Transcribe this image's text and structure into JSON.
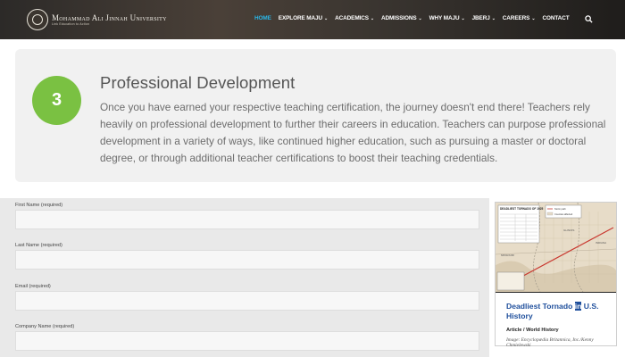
{
  "header": {
    "logo_name": "Mohammad Ali Jinnah University",
    "logo_subtitle": "Link Education to Action",
    "nav": [
      {
        "label": "HOME",
        "active": true,
        "dropdown": false
      },
      {
        "label": "EXPLORE MAJU",
        "active": false,
        "dropdown": true
      },
      {
        "label": "ACADEMICS",
        "active": false,
        "dropdown": true
      },
      {
        "label": "ADMISSIONS",
        "active": false,
        "dropdown": true
      },
      {
        "label": "WHY MAJU",
        "active": false,
        "dropdown": true
      },
      {
        "label": "JBERJ",
        "active": false,
        "dropdown": true
      },
      {
        "label": "CAREERS",
        "active": false,
        "dropdown": true
      },
      {
        "label": "CONTACT",
        "active": false,
        "dropdown": false
      }
    ],
    "search_icon": "search-icon",
    "active_color": "#29b6e8"
  },
  "card": {
    "step_number": "3",
    "step_color": "#7ac142",
    "title": "Professional Development",
    "body": "Once you have earned your respective teaching certification, the journey doesn't end there! Teachers rely heavily on professional development to further their careers in education. Teachers can purpose professional development in a variety of ways, like continued higher education, such as pursuing a master or doctoral degree, or through additional teacher certifications to boost their teaching credentials."
  },
  "form": {
    "fields": [
      {
        "label": "First Name (required)",
        "value": "",
        "placeholder": ""
      },
      {
        "label": "Last Name (required)",
        "value": "",
        "placeholder": ""
      },
      {
        "label": "Email (required)",
        "value": "",
        "placeholder": ""
      },
      {
        "label": "Company Name (required)",
        "value": "",
        "placeholder": ""
      }
    ]
  },
  "ad": {
    "title_before": "Deadliest Tornado ",
    "title_highlight": "in",
    "title_after": " U.S. History",
    "category": "Article / World History",
    "credit": "Image: Encyclopædia Britannica, Inc./Kenny Chmielewski",
    "map_title": "DEADLIEST TORNADO OF 1925",
    "legend": [
      "Storm path",
      "Counties affected"
    ],
    "states": [
      "ILLINOIS",
      "MISSOURI",
      "INDIANA"
    ],
    "title_color": "#1f4f9c"
  }
}
